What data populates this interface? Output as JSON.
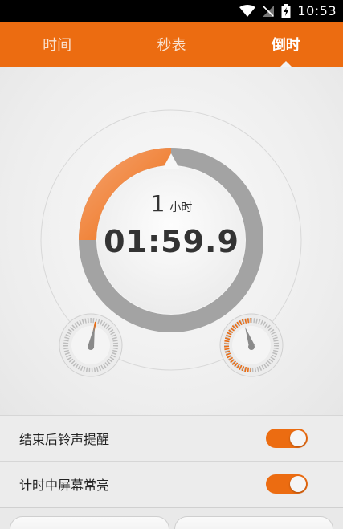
{
  "status_bar": {
    "time": "10:53",
    "icons": [
      "wifi-icon",
      "signal-off-icon",
      "battery-charging-icon"
    ]
  },
  "tabs": [
    {
      "label": "时间",
      "active": false
    },
    {
      "label": "秒表",
      "active": false
    },
    {
      "label": "倒时",
      "active": true
    }
  ],
  "timer": {
    "hours_value": "1",
    "hours_unit": "小时",
    "display": "01:59.9"
  },
  "settings": [
    {
      "label": "结束后铃声提醒",
      "enabled": true
    },
    {
      "label": "计时中屏幕常亮",
      "enabled": true
    }
  ],
  "colors": {
    "accent": "#ec6c11",
    "ring_gray": "#a3a3a3",
    "text_dark": "#333333"
  }
}
